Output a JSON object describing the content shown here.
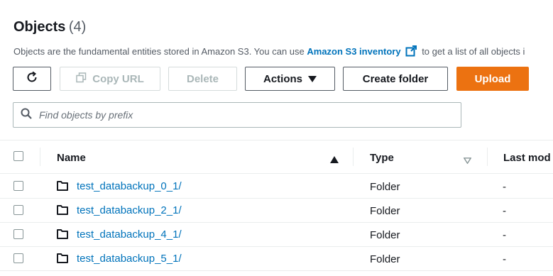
{
  "header": {
    "title": "Objects",
    "count": "(4)"
  },
  "description": {
    "before": "Objects are the fundamental entities stored in Amazon S3. You can use ",
    "link": "Amazon S3 inventory",
    "after": " to get a list of all objects i"
  },
  "toolbar": {
    "copy_url": "Copy URL",
    "delete": "Delete",
    "actions": "Actions",
    "create_folder": "Create folder",
    "upload": "Upload"
  },
  "search": {
    "placeholder": "Find objects by prefix"
  },
  "table": {
    "columns": {
      "name": "Name",
      "type": "Type",
      "last_modified": "Last mod"
    },
    "rows": [
      {
        "name": "test_databackup_0_1/",
        "type": "Folder",
        "last_modified": "-"
      },
      {
        "name": "test_databackup_2_1/",
        "type": "Folder",
        "last_modified": "-"
      },
      {
        "name": "test_databackup_4_1/",
        "type": "Folder",
        "last_modified": "-"
      },
      {
        "name": "test_databackup_5_1/",
        "type": "Folder",
        "last_modified": "-"
      }
    ]
  },
  "colors": {
    "primary": "#ec7211",
    "link": "#0073bb",
    "text": "#16191f",
    "muted": "#545b64"
  }
}
